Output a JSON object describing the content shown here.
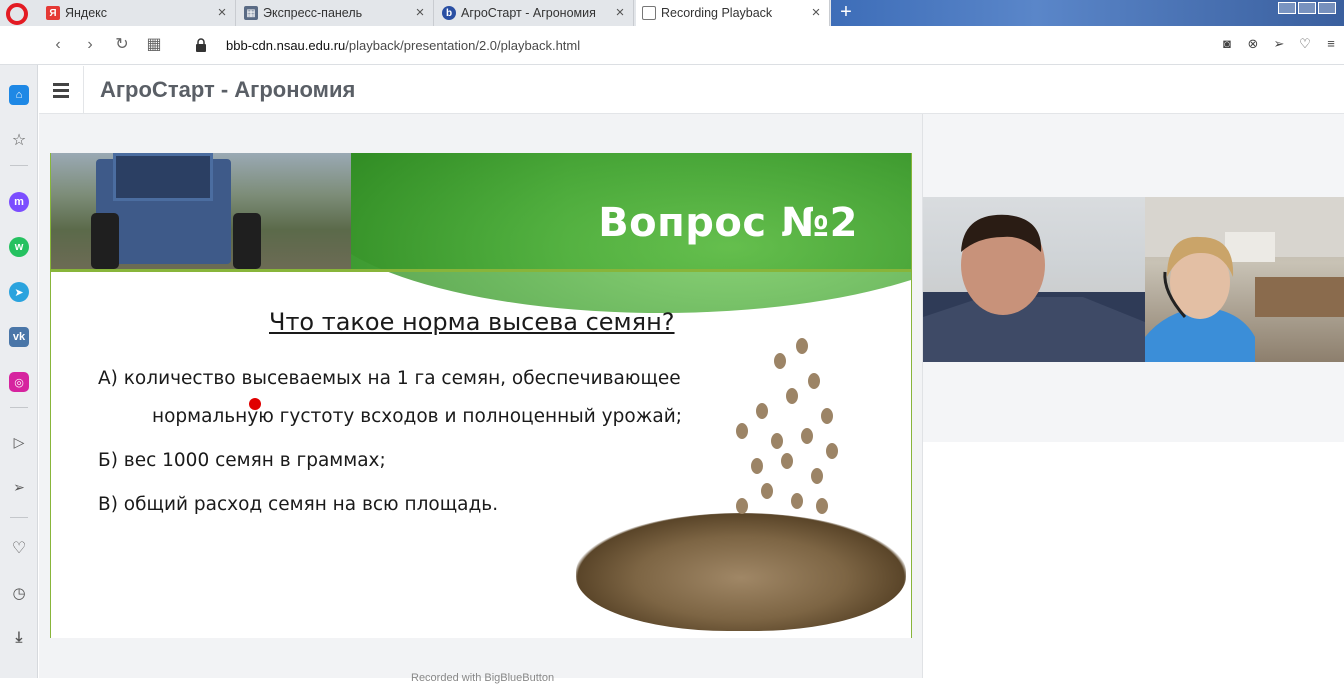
{
  "browser": {
    "tabs": [
      {
        "label": "Яндекс",
        "icon": "yandex-icon",
        "color": "#e53935"
      },
      {
        "label": "Экспресс-панель",
        "icon": "speed-dial-icon",
        "color": "#5a6b85"
      },
      {
        "label": "АгроСтарт - Агрономия",
        "icon": "bigbluebutton-icon",
        "color": "#2a4fa3"
      },
      {
        "label": "Recording Playback",
        "icon": "document-icon",
        "color": "#555555"
      }
    ],
    "url_domain": "bbb-cdn.nsau.edu.ru",
    "url_path": "/playback/presentation/2.0/playback.html"
  },
  "sidebar": {
    "items": [
      {
        "icon": "home-icon"
      },
      {
        "icon": "star-icon"
      },
      {
        "icon": "messenger-icon"
      },
      {
        "icon": "whatsapp-icon"
      },
      {
        "icon": "telegram-icon"
      },
      {
        "icon": "vk-icon"
      },
      {
        "icon": "instagram-icon"
      },
      {
        "icon": "player-icon"
      },
      {
        "icon": "send-icon"
      },
      {
        "icon": "heart-icon"
      },
      {
        "icon": "history-icon"
      },
      {
        "icon": "download-icon"
      }
    ]
  },
  "app": {
    "title": "АгроСтарт - Агрономия"
  },
  "slide": {
    "heading": "Вопрос №2",
    "question": "Что такое норма высева семян?",
    "answer_a_line1": "А)  количество высеваемых на 1 га семян, обеспечивающее",
    "answer_a_line2": "нормальную густоту всходов и полноценный урожай;",
    "answer_b": "Б) вес 1000 семян в граммах;",
    "answer_c": "В) общий расход семян на всю площадь."
  },
  "footer": {
    "text": "Recorded with BigBlueButton"
  },
  "colors": {
    "accent_green": "#3e9b32",
    "opera_red": "#e31b23",
    "pointer_red": "#e00000"
  }
}
